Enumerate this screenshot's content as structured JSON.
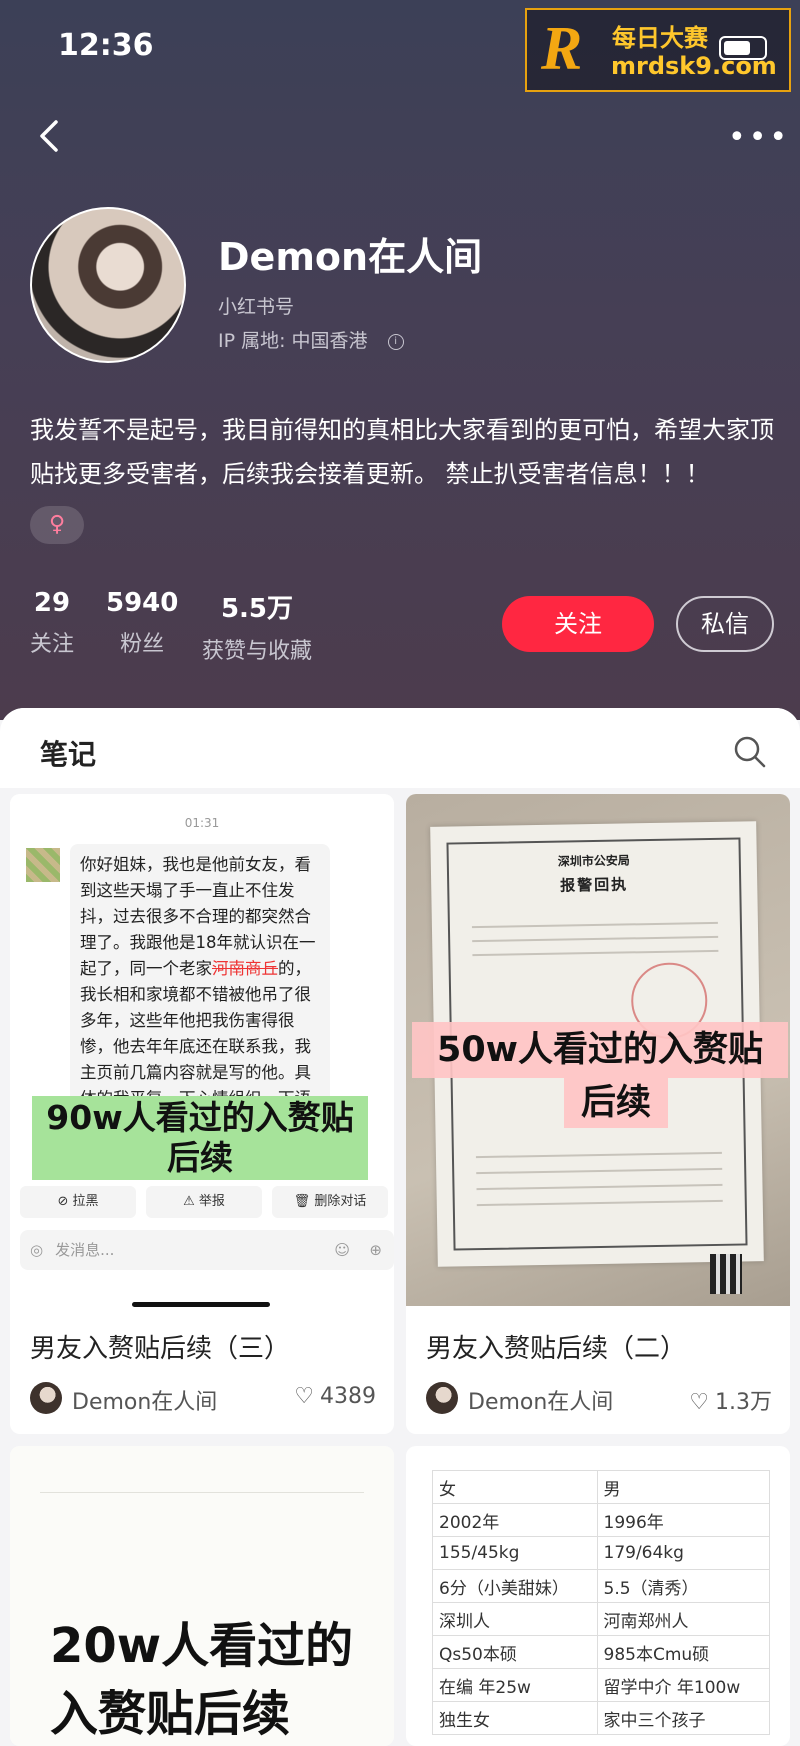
{
  "status_bar": {
    "time": "12:36"
  },
  "watermark": {
    "letter": "R",
    "text_cn": "每日大赛",
    "url": "mrdsk9.com"
  },
  "profile": {
    "name": "Demon在人间",
    "account_label": "小红书号",
    "ip_location": "IP 属地: 中国香港",
    "bio": "我发誓不是起号，我目前得知的真相比大家看到的更可怕，希望大家顶贴找更多受害者，后续我会接着更新。 禁止扒受害者信息！！！",
    "gender_symbol": "♀",
    "stats": [
      {
        "value": "29",
        "label": "关注"
      },
      {
        "value": "5940",
        "label": "粉丝"
      },
      {
        "value": "5.5万",
        "label": "获赞与收藏"
      }
    ],
    "follow_label": "关注",
    "message_label": "私信"
  },
  "notes": {
    "tab_label": "笔记",
    "cards": [
      {
        "title": "男友入赘贴后续（三）",
        "author": "Demon在人间",
        "likes": "4389",
        "cover": {
          "time": "01:31",
          "message_pre": "你好姐妹，我也是他前女友，看到这些天塌了手一直止不住发抖，过去很多不合理的都突然合理了。我跟他是18年就认识在一起了，同一个老家",
          "message_strike": "河南商丘",
          "message_post": "的，我长相和家境都不错被他吊了很多年，这些年他把我伤害得很惨，他去年年底还在联系我，我主页前几篇内容就是写的他。具体的我平复一下心情组织一下语言，请问下有没有受害者",
          "banner_line1": "90w人看过的入赘贴",
          "banner_line2": "后续",
          "actions": [
            "拉黑",
            "举报",
            "删除对话"
          ],
          "input_placeholder": "发消息..."
        }
      },
      {
        "title": "男友入赘贴后续（二）",
        "author": "Demon在人间",
        "likes": "1.3万",
        "cover": {
          "doc_title": "深圳市公安局",
          "doc_subtitle": "报警回执",
          "banner_line1": "50w人看过的入赘贴",
          "banner_line2": "后续"
        }
      },
      {
        "cover": {
          "line1": "20w人看过的",
          "line2": "入赘贴后续"
        }
      },
      {
        "cover": {
          "table_rows": [
            [
              "女",
              "男"
            ],
            [
              "2002年",
              "1996年"
            ],
            [
              "155/45kg",
              "179/64kg"
            ],
            [
              "6分（小美甜妹）",
              "5.5（清秀）"
            ],
            [
              "深圳人",
              "河南郑州人"
            ],
            [
              "Qs50本硕",
              "985本Cmu硕"
            ],
            [
              "在编 年25w",
              "留学中介 年100w"
            ],
            [
              "独生女",
              "家中三个孩子"
            ]
          ]
        }
      }
    ]
  }
}
